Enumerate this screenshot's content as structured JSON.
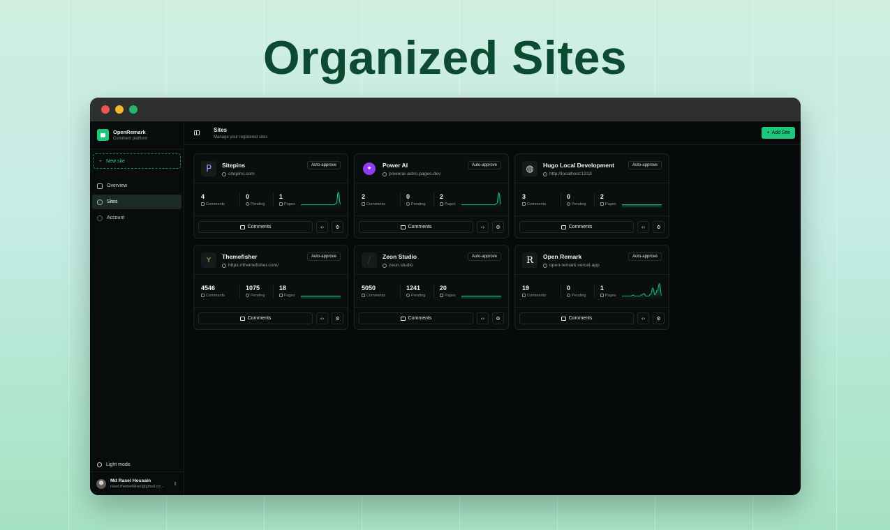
{
  "hero": {
    "title": "Organized Sites"
  },
  "sidebar": {
    "brand_name": "OpenRemark",
    "brand_sub": "Comment platform",
    "new_site": "New site",
    "items": [
      {
        "label": "Overview",
        "icon": "grid-icon"
      },
      {
        "label": "Sites",
        "icon": "globe-icon"
      },
      {
        "label": "Account",
        "icon": "gear-icon"
      }
    ],
    "light_mode": "Light mode",
    "user_name": "Md Rasel Hossain",
    "user_email": "rasel.themefisher@gmail.co..."
  },
  "header": {
    "title": "Sites",
    "subtitle": "Manage your registered sites",
    "add_button": "Add Site"
  },
  "labels": {
    "comments": "Comments",
    "pending": "Pending",
    "pages": "Pages",
    "badge": "Auto-approve",
    "comments_button": "Comments"
  },
  "colors": {
    "accent": "#1ec77a",
    "hero": "#0c4a32"
  },
  "sites": [
    {
      "name": "Sitepins",
      "url": "sitepins.com",
      "comments": "4",
      "pending": "0",
      "pages": "1",
      "icon": "P",
      "trend": [
        0,
        0,
        0,
        0,
        0,
        0,
        0,
        0,
        0,
        0,
        0,
        0,
        0,
        0,
        0,
        0,
        0.1,
        1,
        0.05
      ]
    },
    {
      "name": "Power AI",
      "url": "powerai-astro.pages.dev",
      "comments": "2",
      "pending": "0",
      "pages": "2",
      "icon": "✦",
      "trend": [
        0,
        0,
        0,
        0,
        0,
        0,
        0,
        0,
        0,
        0,
        0,
        0,
        0,
        0,
        0,
        0,
        0.1,
        0.95,
        0.05
      ]
    },
    {
      "name": "Hugo Local Development",
      "url": "http://localhost:1313",
      "comments": "3",
      "pending": "0",
      "pages": "2",
      "icon": "◍",
      "trend": [
        0,
        0,
        0,
        0,
        0,
        0,
        0,
        0,
        0,
        0,
        0,
        0,
        0,
        0,
        0,
        0,
        0,
        0,
        0
      ]
    },
    {
      "name": "Themefisher",
      "url": "https://themefisher.com/",
      "comments": "4546",
      "pending": "1075",
      "pages": "18",
      "icon": "Y",
      "trend": [
        0,
        0,
        0,
        0,
        0,
        0,
        0,
        0,
        0,
        0,
        0,
        0,
        0,
        0,
        0,
        0,
        0,
        0,
        0
      ]
    },
    {
      "name": "Zeon Studio",
      "url": "zeon.studio",
      "comments": "5050",
      "pending": "1241",
      "pages": "20",
      "icon": "/",
      "trend": [
        0,
        0,
        0,
        0,
        0,
        0,
        0,
        0,
        0,
        0,
        0,
        0,
        0,
        0,
        0,
        0,
        0,
        0,
        0
      ]
    },
    {
      "name": "Open Remark",
      "url": "open-remark.vercel.app",
      "comments": "19",
      "pending": "0",
      "pages": "1",
      "icon": "R",
      "trend": [
        0,
        0,
        0,
        0,
        0,
        0.08,
        0,
        0,
        0,
        0.1,
        0.2,
        0,
        0,
        0.15,
        0.65,
        0.1,
        0.45,
        1,
        0.05
      ]
    }
  ]
}
